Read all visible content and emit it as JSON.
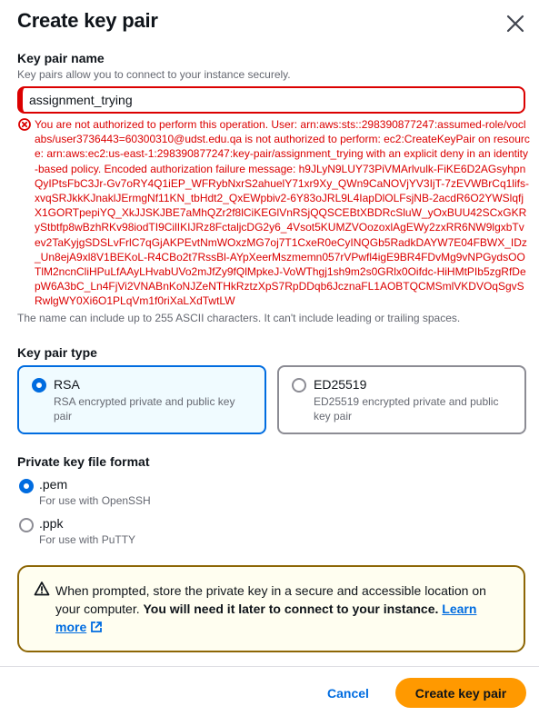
{
  "modal": {
    "title": "Create key pair"
  },
  "key_pair_name": {
    "label": "Key pair name",
    "description": "Key pairs allow you to connect to your instance securely.",
    "value": "assignment_trying",
    "error": "You are not authorized to perform this operation. User: arn:aws:sts::298390877247:assumed-role/voclabs/user3736443=60300310@udst.edu.qa is not authorized to perform: ec2:CreateKeyPair on resource: arn:aws:ec2:us-east-1:298390877247:key-pair/assignment_trying with an explicit deny in an identity-based policy. Encoded authorization failure message: h9JLyN9LUY73PiVMArlvulk-FiKE6D2AGsyhpnQyIPtsFbC3Jr-Gv7oRY4Q1iEP_WFRybNxrS2ahuelY71xr9Xy_QWn9CaNOVjYV3IjT-7zEVWBrCq1lifs-xvqSRJkkKJnaklJErmgNf11KN_tbHdt2_QxEWpbiv2-6Y83oJRL9L4IapDlOLFsjNB-2acdR6O2YWSlqfjX1GORTpepiYQ_XkJJSKJBE7aMhQZr2f8lCiKEGlVnRSjQQSCEBtXBDRcSluW_yOxBUU42SCxGKRyStbtfp8wBzhRKv98iodTI9CilIKIJRz8FctaljcDG2y6_4Vsot5KUMZVOozoxlAgEWy2zxRR6NW9lgxbTvev2TaKyjgSDSLvFrlC7qGjAKPEvtNmWOxzMG7oj7T1CxeR0eCyINQGb5RadkDAYW7E04FBWX_IDz_Un8ejA9xl8V1BEKoL-R4CBo2t7RssBl-AYpXeerMszmemn057rVPwfl4igE9BR4FDvMg9vNPGydsOOTlM2ncnCliHPuLfAAyLHvabUVo2mJfZy9fQlMpkeJ-VoWThgj1sh9m2s0GRlx0Oifdc-HiHMtPIb5zgRfDepW6A3bC_Ln4FjVi2VNABnKoNJZeNTHkRztzXpS7RpDDqb6JcznaFL1AOBTQCMSmlVKDVOqSgvSRwlgWY0Xi6O1PLqVm1f0riXaLXdTwtLW",
    "constraint": "The name can include up to 255 ASCII characters. It can't include leading or trailing spaces."
  },
  "key_pair_type": {
    "label": "Key pair type",
    "options": [
      {
        "title": "RSA",
        "description": "RSA encrypted private and public key pair",
        "selected": true
      },
      {
        "title": "ED25519",
        "description": "ED25519 encrypted private and public key pair",
        "selected": false
      }
    ]
  },
  "private_key_format": {
    "label": "Private key file format",
    "options": [
      {
        "title": ".pem",
        "description": "For use with OpenSSH",
        "selected": true
      },
      {
        "title": ".ppk",
        "description": "For use with PuTTY",
        "selected": false
      }
    ]
  },
  "alert": {
    "text": "When prompted, store the private key in a secure and accessible location on your computer.",
    "bold_text": "You will need it later to connect to your instance.",
    "link_text": "Learn more"
  },
  "footer": {
    "cancel_label": "Cancel",
    "create_label": "Create key pair"
  },
  "colors": {
    "primary_blue": "#006ce0",
    "error_red": "#db0000",
    "warning_border": "#8d6605",
    "warning_bg": "#fffef0",
    "create_button": "#ff9900"
  },
  "icons": [
    "close-icon",
    "error-icon",
    "warning-icon",
    "external-link-icon"
  ]
}
